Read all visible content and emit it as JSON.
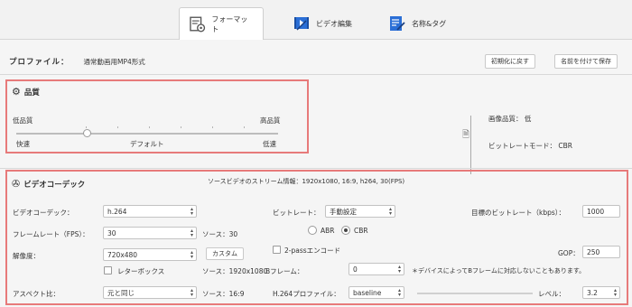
{
  "tabs": [
    {
      "label": "フォーマット",
      "active": true
    },
    {
      "label": "ビデオ編集",
      "active": false
    },
    {
      "label": "名称&タグ",
      "active": false
    }
  ],
  "profile": {
    "label": "プロファイル：",
    "value": "通常動画用MP4形式"
  },
  "buttons": {
    "reset": "初期化に戻す",
    "save_as": "名前を付けて保存"
  },
  "quality": {
    "title": "品質",
    "low": "低品質",
    "high": "高品質",
    "fast": "快速",
    "default": "デフォルト",
    "slow": "低速",
    "level": 0.27
  },
  "info": {
    "image_quality": "画像品質： 低",
    "bitrate_mode": "ビットレートモード： CBR"
  },
  "codec": {
    "title": "ビデオコーデック",
    "source_info": "ソースビデオのストリーム情報：1920x1080, 16:9, h264, 30(FPS)",
    "video_codec_label": "ビデオコーデック：",
    "video_codec_value": "h.264",
    "fps_label": "フレームレート（FPS）：",
    "fps_value": "30",
    "fps_source": "ソース：30",
    "resolution_label": "解像度：",
    "resolution_value": "720x480",
    "custom_btn": "カスタム",
    "letterbox_label": "レターボックス",
    "res_source": "ソース：1920x1080",
    "aspect_label": "アスペクト比：",
    "aspect_value": "元と同じ",
    "aspect_source": "ソース：16:9",
    "bitrate_label": "ビットレート：",
    "bitrate_value": "手動設定",
    "abr": "ABR",
    "cbr": "CBR",
    "twopass": "2-passエンコード",
    "bframe_label": "Bフレーム：",
    "bframe_value": "0",
    "bframe_note": "＊デバイスによってBフレームに対応しないこともあります。",
    "profile264_label": "H.264プロファイル：",
    "profile264_value": "baseline",
    "target_bitrate_label": "目標のビットレート（kbps）：",
    "target_bitrate_value": "1000",
    "gop_label": "GOP：",
    "gop_value": "250",
    "level_label": "レベル：",
    "level_value": "3.2"
  },
  "colors": {
    "accent": "#e77a7a"
  }
}
